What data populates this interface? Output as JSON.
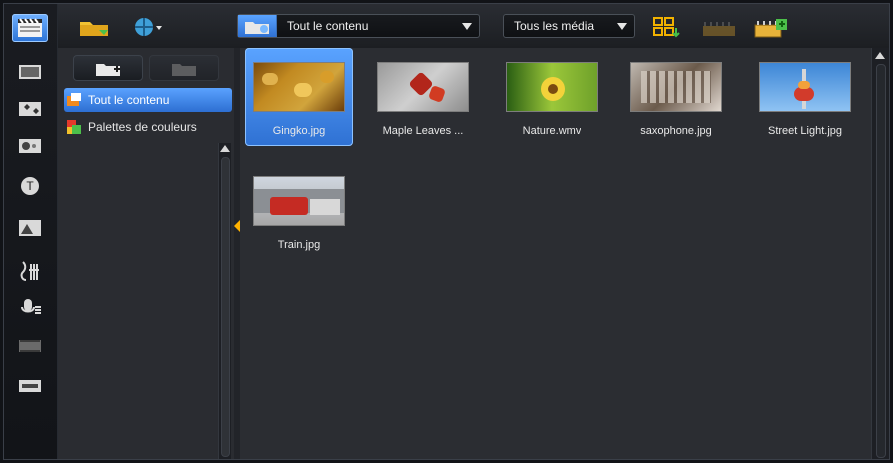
{
  "toolbar": {
    "left_tools": [
      {
        "name": "media-library-icon"
      },
      {
        "name": "instant-project-icon"
      },
      {
        "name": "transition-icon"
      },
      {
        "name": "title-icon"
      },
      {
        "name": "graphics-icon"
      },
      {
        "name": "filter-icon"
      },
      {
        "name": "audio-icon"
      },
      {
        "name": "record-icon"
      },
      {
        "name": "motion-icon"
      },
      {
        "name": "subtitle-icon"
      }
    ],
    "top": {
      "library_dropdown": "Tout le contenu",
      "media_filter_dropdown": "Tous les média"
    }
  },
  "library_panel": {
    "tree": [
      {
        "label": "Tout le contenu",
        "selected": true
      },
      {
        "label": "Palettes de couleurs",
        "selected": false
      }
    ]
  },
  "content": {
    "items": [
      {
        "label": "Gingko.jpg",
        "selected": true
      },
      {
        "label": "Maple Leaves ...",
        "selected": false
      },
      {
        "label": "Nature.wmv",
        "selected": false
      },
      {
        "label": "saxophone.jpg",
        "selected": false
      },
      {
        "label": "Street Light.jpg",
        "selected": false
      },
      {
        "label": "Train.jpg",
        "selected": false
      }
    ]
  },
  "colors": {
    "accent": "#2f71d3",
    "accent_light": "#5aa3ff",
    "splitter_arrow": "#ffb200"
  }
}
